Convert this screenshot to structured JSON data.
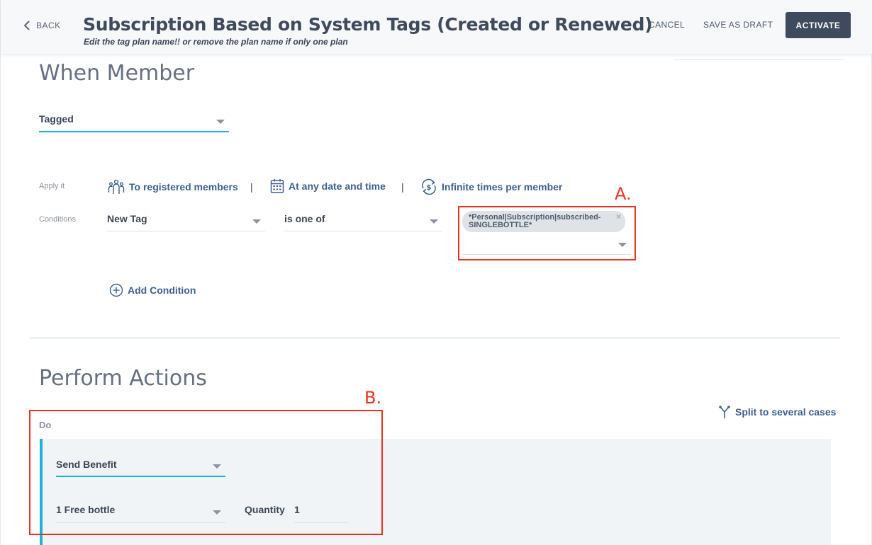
{
  "header": {
    "back_label": "BACK",
    "title": "Subscription Based on System Tags (Created or Renewed)",
    "subtitle": "Edit the tag plan name!! or remove the plan name if only one plan",
    "cancel_label": "CANCEL",
    "save_draft_label": "SAVE AS DRAFT",
    "activate_label": "ACTIVATE"
  },
  "when_member": {
    "title": "When Member",
    "trigger_value": "Tagged"
  },
  "apply_it": {
    "label": "Apply it",
    "registered": "To registered members",
    "separator": "|",
    "date_time": "At any date and time",
    "times": "Infinite times per member"
  },
  "conditions": {
    "label": "Conditions",
    "field": "New Tag",
    "operator": "is one of",
    "tag_value": "*Personal|Subscription|subscribed-SINGLEBOTTLE*",
    "remove_symbol": "×",
    "add_label": "Add Condition"
  },
  "annotations": {
    "a_label": "A.",
    "b_label": "B.",
    "color": "#e8331f"
  },
  "perform_actions": {
    "title": "Perform Actions",
    "split_label": "Split to several cases",
    "do_label": "Do",
    "action_type": "Send Benefit",
    "benefit": "1 Free bottle",
    "quantity_label": "Quantity",
    "quantity_value": "1"
  },
  "colors": {
    "accent": "#1cb0dd",
    "link": "#3b5f94",
    "primary_button": "#3e4a5d"
  }
}
